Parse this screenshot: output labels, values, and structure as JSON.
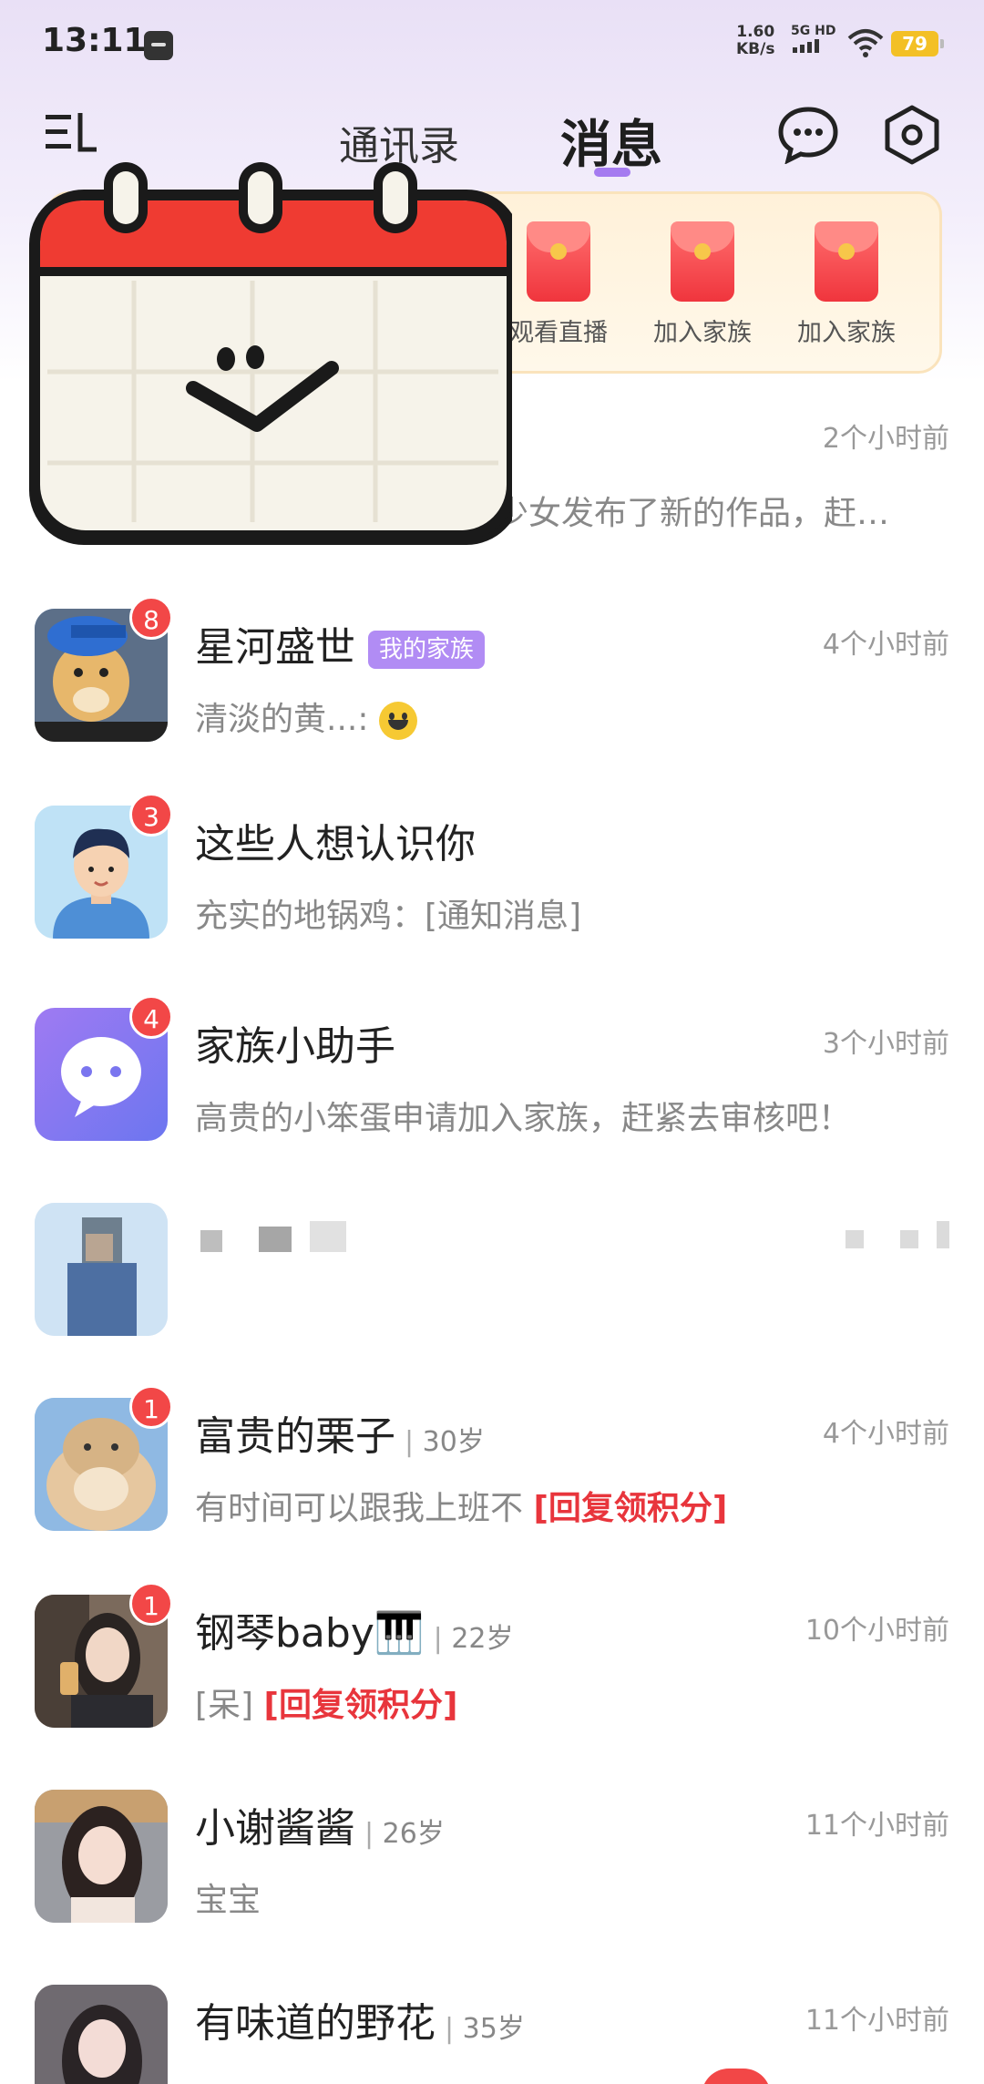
{
  "status_bar": {
    "time": "13:11",
    "speed_value": "1.60",
    "speed_unit": "KB/s",
    "network": "5G HD",
    "battery": "79"
  },
  "header": {
    "tab_contacts": "通讯录",
    "tab_messages": "消息",
    "icons": [
      "menu-icon",
      "chat-bubble-icon",
      "settings-hex-icon"
    ]
  },
  "banner": {
    "items": [
      {
        "label": "观看直播"
      },
      {
        "label": "加入家族"
      },
      {
        "label": "加入家族"
      }
    ]
  },
  "first_row": {
    "time": "2个小时前",
    "preview_partial": "少女发布了新的作品，赶…"
  },
  "messages": [
    {
      "name": "星河盛世",
      "tag": "我的家族",
      "badge": "8",
      "time": "4个小时前",
      "preview": "清淡的黄...: ",
      "avatar": "dog-avatar"
    },
    {
      "name": "这些人想认识你",
      "badge": "3",
      "time": "",
      "preview": "充实的地锅鸡：[通知消息]",
      "avatar": "cartoon-man-avatar"
    },
    {
      "name": "家族小助手",
      "badge": "4",
      "time": "3个小时前",
      "preview": "高贵的小笨蛋申请加入家族，赶紧去审核吧！",
      "avatar": "chat-bot-avatar"
    },
    {
      "name": "",
      "badge": "",
      "time": "",
      "preview": "",
      "avatar": "blurred-avatar"
    },
    {
      "name": "富贵的栗子",
      "age": "30岁",
      "badge": "1",
      "time": "4个小时前",
      "preview": "有时间可以跟我上班不 ",
      "highlight": "[回复领积分]",
      "avatar": "cat-avatar"
    },
    {
      "name": "钢琴baby🎹",
      "age": "22岁",
      "badge": "1",
      "time": "10个小时前",
      "preview": "[呆] ",
      "highlight": "[回复领积分]",
      "avatar": "woman-avatar-1"
    },
    {
      "name": "小谢酱酱",
      "age": "26岁",
      "badge": "",
      "time": "11个小时前",
      "preview": "宝宝",
      "avatar": "woman-avatar-2"
    },
    {
      "name": "有味道的野花",
      "age": "35岁",
      "badge": "",
      "time": "11个小时前",
      "preview": "",
      "avatar": "woman-avatar-3"
    }
  ],
  "colors": {
    "accent": "#a57bf0",
    "badge": "#f24747",
    "highlight": "#e8353c",
    "tag": "#b18cf4"
  }
}
